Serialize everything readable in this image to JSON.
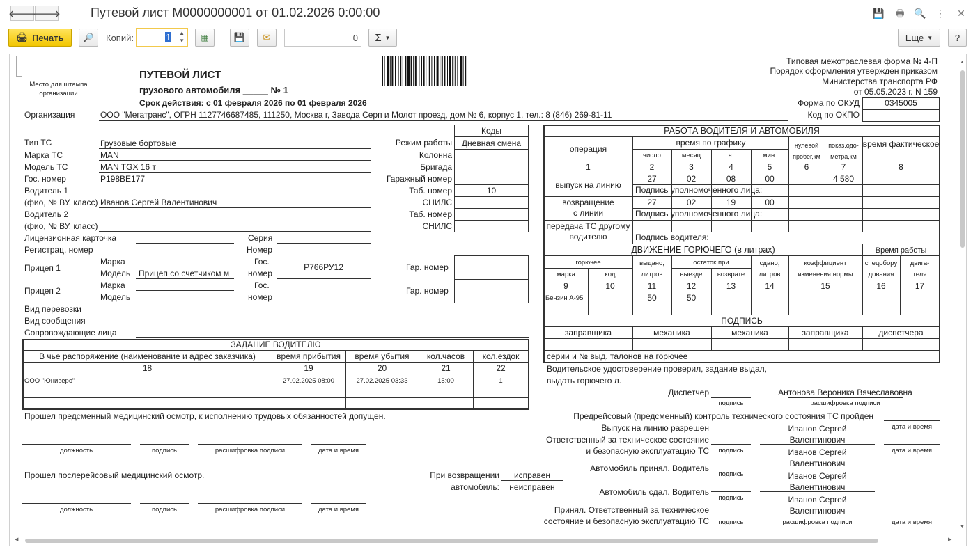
{
  "window": {
    "title": "Путевой лист М0000000001 от 01.02.2026 0:00:00"
  },
  "toolbar": {
    "print_label": "Печать",
    "copies_label": "Копий:",
    "copies_value": "1",
    "sum_value": "0",
    "sigma": "Σ",
    "more_label": "Еще",
    "help_label": "?"
  },
  "header": {
    "stamp": "Место для штампа организации",
    "doc_title": "ПУТЕВОЙ ЛИСТ",
    "doc_subtitle": "грузового автомобиля _____ № 1",
    "validity": "Срок действия: с 01 февраля 2026 по 01 февраля 2026",
    "form_lines": [
      "Типовая межотраслевая форма № 4-П",
      "Порядок оформления утвержден приказом",
      "Министерства транспорта РФ",
      "от 05.05.2023 г. N 159"
    ],
    "okud_label": "Форма по ОКУД",
    "okud_value": "0345005",
    "okpo_label": "Код по ОКПО",
    "org_label": "Организация",
    "org_value": "ООО \"Мегатранс\", ОГРН 1127746687485, 111250, Москва г, Завода Серп и Молот проезд, дом № 6, корпус 1, тел.: 8 (846) 269-81-11"
  },
  "vehicle": {
    "type_label": "Тип ТС",
    "type_value": "Грузовые бортовые",
    "brand_label": "Марка ТС",
    "brand_value": "MAN",
    "model_label": "Модель ТС",
    "model_value": "MAN TGX 16 т",
    "plate_label": "Гос. номер",
    "plate_value": "Р198ВЕ177",
    "driver1_label": "Водитель 1",
    "driver_sub": "(фио, № ВУ, класс)",
    "driver1_value": "Иванов Сергей Валентинович",
    "driver2_label": "Водитель 2",
    "license_card": "Лицензионная карточка",
    "reg_number": "Регистрац. номер",
    "series": "Серия",
    "number": "Номер",
    "trailer1": "Прицеп 1",
    "trailer2": "Прицеп 2",
    "brand_short": "Марка",
    "model_short": "Модель",
    "trailer_model_value": "Прицеп со счетчиком м",
    "gos_label": "Гос.",
    "nomer_label": "номер",
    "trailer_plate_value": "Р766РУ12",
    "garage_no": "Гар. номер",
    "transport_type": "Вид перевозки",
    "message_type": "Вид сообщения",
    "escort": "Сопровождающие лица"
  },
  "codes": {
    "title": "Коды",
    "work_mode_label": "Режим работы",
    "work_mode_value": "Дневная смена",
    "column": "Колонна",
    "brigade": "Бригада",
    "garage_number": "Гаражный номер",
    "tab_number": "Таб. номер",
    "tab_value": "10",
    "snils": "СНИЛС"
  },
  "work": {
    "title": "РАБОТА ВОДИТЕЛЯ И АВТОМОБИЛЯ",
    "operation": "операция",
    "schedule": "время по графику",
    "day": "число",
    "month": "месяц",
    "hour": "ч.",
    "min": "мин.",
    "zero_run": "нулевой пробег,км",
    "odo": "показ.одо-метра,км",
    "actual_time": "время фактическое",
    "nums": [
      "1",
      "2",
      "3",
      "4",
      "5",
      "6",
      "7",
      "8"
    ],
    "release": "выпуск на линию",
    "release_vals": [
      "27",
      "02",
      "08",
      "00",
      "4 580"
    ],
    "sign_auth": "Подпись уполномоченного лица:",
    "return": "возвращение с линии",
    "return_vals": [
      "27",
      "02",
      "19",
      "00"
    ],
    "transfer": "передача ТС другому водителю",
    "driver_sign": "Подпись водителя:"
  },
  "fuel": {
    "title": "ДВИЖЕНИЕ ГОРЮЧЕГО (в литрах)",
    "work_time": "Время работы",
    "fuel": "горючее",
    "brand": "марка",
    "code": "код",
    "issued": "выдано, литров",
    "remain": "остаток при",
    "departure": "выезде",
    "return": "возврате",
    "handed": "сдано, литров",
    "coef": "коэффициент изменения нормы",
    "special": "спецобору дования",
    "engine": "двига-теля",
    "nums": [
      "9",
      "10",
      "11",
      "12",
      "13",
      "14",
      "15",
      "16",
      "17"
    ],
    "row_brand": "Бензин А-95",
    "row_issued": "50",
    "row_departure": "50",
    "sign_title": "ПОДПИСЬ",
    "signers": [
      "заправщика",
      "механика",
      "механика",
      "заправщика",
      "диспетчера"
    ],
    "coupons": "серии и № выд. талонов на горючее"
  },
  "task": {
    "title": "ЗАДАНИЕ ВОДИТЕЛЮ",
    "headers": [
      "В чье распоряжение (наименование и адрес заказчика)",
      "время прибытия",
      "время убытия",
      "кол.часов",
      "кол.ездок"
    ],
    "nums": [
      "18",
      "19",
      "20",
      "21",
      "22"
    ],
    "row": [
      "ООО \"Юниверс\"",
      "27.02.2025 08:00",
      "27.02.2025 03:33",
      "15:00",
      "1"
    ]
  },
  "bottom": {
    "pre_med": "Прошел предсменный медицинский осмотр, к исполнению трудовых обязанностей допущен.",
    "post_med": "Прошел послерейсовый медицинский осмотр.",
    "position": "должность",
    "signature": "подпись",
    "decoding": "расшифровка подписи",
    "datetime": "дата и время",
    "on_return": "При возвращении",
    "car": "автомобиль:",
    "ok": "исправен",
    "not_ok": "неисправен",
    "license_checked": "Водительское удостоверение проверил, задание выдал,",
    "fuel_issue": "выдать горючего  л.",
    "dispatcher": "Диспетчер",
    "dispatcher_name": "Антонова Вероника Вячеславовна",
    "precheck": "Предрейсовый (предсменный) контроль технического состояния ТС пройден",
    "release_allowed": "Выпуск на линию разрешен",
    "responsible1": "Ответственный за техническое состояние",
    "responsible2": "и безопасную эксплуатацию ТС",
    "accepted": "Автомобиль принял. Водитель",
    "handed": "Автомобиль сдал. Водитель",
    "accepted_resp1": "Принял. Ответственный за техническое",
    "accepted_resp2": "состояние и безопасную эксплуатацию ТС",
    "driver_first": "Иванов Сергей",
    "driver_last": "Валентинович"
  },
  "icons": {
    "back": "arrow-left-icon",
    "forward": "arrow-right-icon",
    "preview": "preview-icon",
    "save": "save-icon",
    "mail": "mail-icon",
    "settings": "table-settings-icon"
  }
}
